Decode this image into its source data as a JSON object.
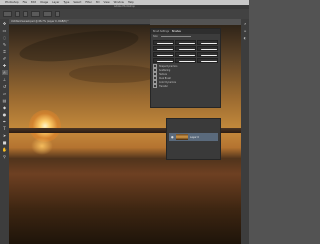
{
  "menubar": {
    "items": [
      "Photoshop",
      "File",
      "Edit",
      "Image",
      "Layer",
      "Type",
      "Select",
      "Filter",
      "3D",
      "View",
      "Window",
      "Help"
    ]
  },
  "app_title": "Adobe Photoshop",
  "document": {
    "tab_title": "Untitled-Sunset.psd @ 66.7% (Layer 0, RGB/8) *"
  },
  "tools": [
    "move",
    "marquee",
    "lasso",
    "quick-select",
    "crop",
    "eyedropper",
    "healing",
    "brush",
    "stamp",
    "history",
    "eraser",
    "gradient",
    "blur",
    "dodge",
    "pen",
    "type",
    "path-select",
    "shape",
    "hand",
    "zoom"
  ],
  "brush_panel": {
    "tabs": [
      "Brush Settings",
      "Brushes"
    ],
    "size_label": "Size:",
    "options": [
      "Shape Dynamics",
      "Scattering",
      "Texture",
      "Dual Brush",
      "Color Dynamics",
      "Transfer"
    ]
  },
  "layers_panel": {
    "layer_name": "Layer 0"
  },
  "colors": {
    "ui_dark": "#3c3c3c",
    "menubar": "#c9c9c9",
    "sun": "#ffce6a",
    "sky": "#c58a3c",
    "layer_selected": "#5a6a7c"
  }
}
